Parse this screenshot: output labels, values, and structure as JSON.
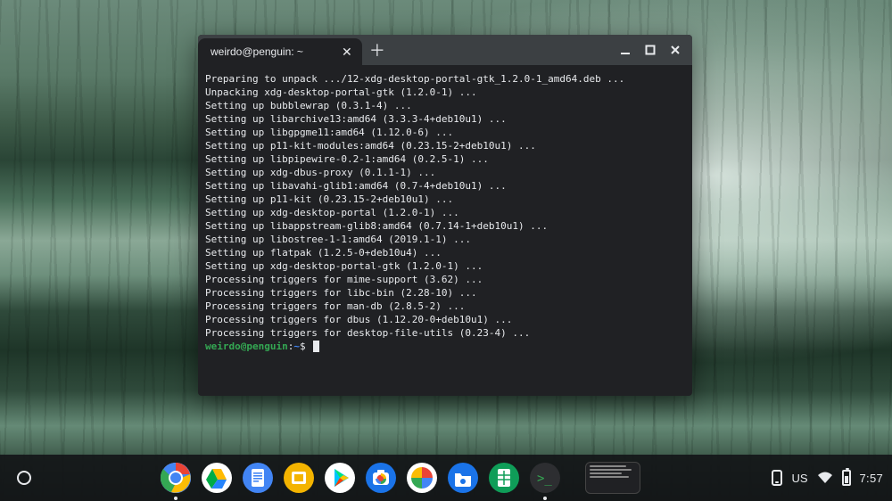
{
  "tab": {
    "title": "weirdo@penguin: ~"
  },
  "terminal": {
    "lines": [
      "Preparing to unpack .../12-xdg-desktop-portal-gtk_1.2.0-1_amd64.deb ...",
      "Unpacking xdg-desktop-portal-gtk (1.2.0-1) ...",
      "Setting up bubblewrap (0.3.1-4) ...",
      "Setting up libarchive13:amd64 (3.3.3-4+deb10u1) ...",
      "Setting up libgpgme11:amd64 (1.12.0-6) ...",
      "Setting up p11-kit-modules:amd64 (0.23.15-2+deb10u1) ...",
      "Setting up libpipewire-0.2-1:amd64 (0.2.5-1) ...",
      "Setting up xdg-dbus-proxy (0.1.1-1) ...",
      "Setting up libavahi-glib1:amd64 (0.7-4+deb10u1) ...",
      "Setting up p11-kit (0.23.15-2+deb10u1) ...",
      "Setting up xdg-desktop-portal (1.2.0-1) ...",
      "Setting up libappstream-glib8:amd64 (0.7.14-1+deb10u1) ...",
      "Setting up libostree-1-1:amd64 (2019.1-1) ...",
      "Setting up flatpak (1.2.5-0+deb10u4) ...",
      "Setting up xdg-desktop-portal-gtk (1.2.0-1) ...",
      "Processing triggers for mime-support (3.62) ...",
      "Processing triggers for libc-bin (2.28-10) ...",
      "Processing triggers for man-db (2.8.5-2) ...",
      "Processing triggers for dbus (1.12.20-0+deb10u1) ...",
      "Processing triggers for desktop-file-utils (0.23-4) ..."
    ],
    "prompt": {
      "user_host": "weirdo@penguin",
      "sep": ":",
      "path": "~",
      "suffix": "$"
    }
  },
  "status": {
    "ime": "US",
    "clock": "7:57"
  },
  "apps": [
    {
      "name": "chrome"
    },
    {
      "name": "drive"
    },
    {
      "name": "docs"
    },
    {
      "name": "slides"
    },
    {
      "name": "play-store"
    },
    {
      "name": "camera"
    },
    {
      "name": "photos"
    },
    {
      "name": "files"
    },
    {
      "name": "sheets"
    },
    {
      "name": "terminal"
    }
  ]
}
